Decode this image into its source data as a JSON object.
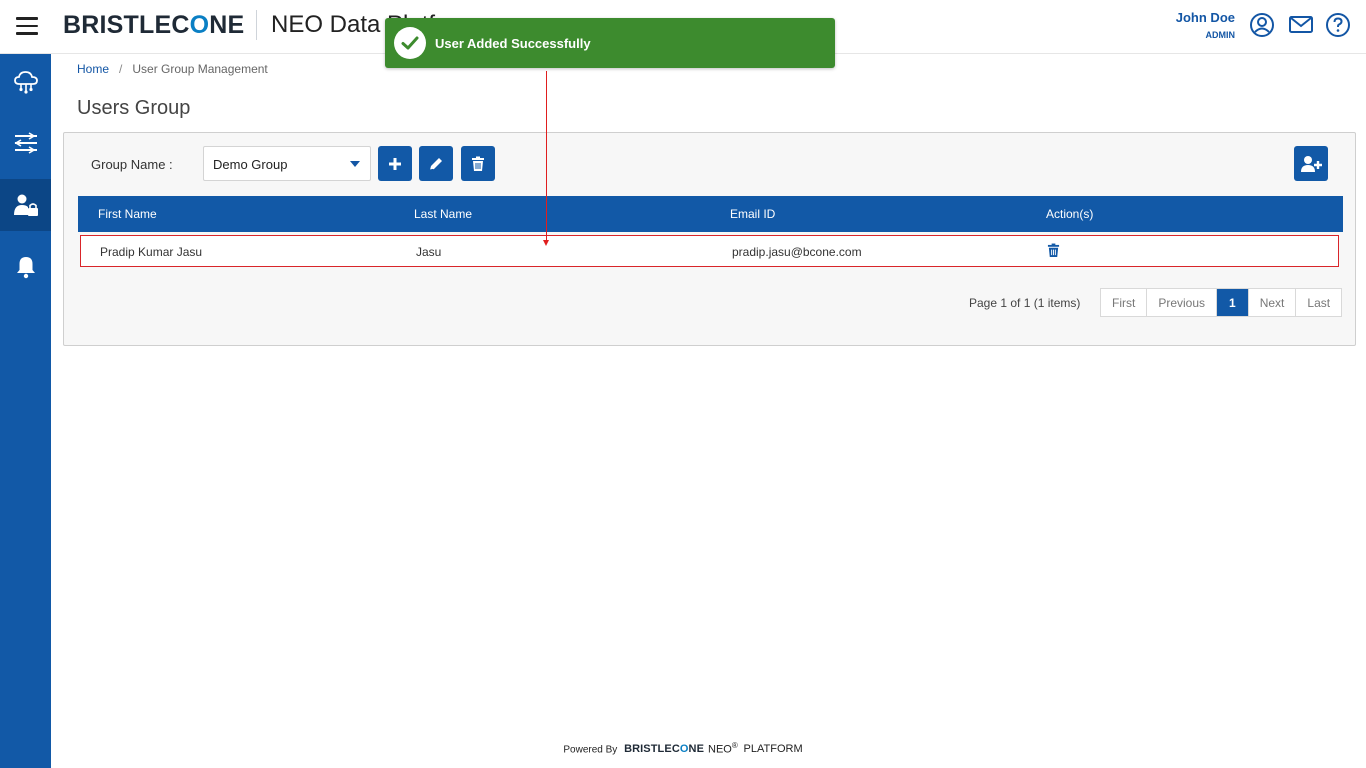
{
  "header": {
    "brand_pre": "BRISTLEC",
    "brand_o": "O",
    "brand_post": "NE",
    "app_title": "NEO Data Platf",
    "user_name": "John Doe",
    "user_role": "ADMIN"
  },
  "toast": {
    "message": "User Added Successfully",
    "color": "#3d8b2e"
  },
  "breadcrumb": {
    "home": "Home",
    "separator": "/",
    "current": "User Group Management"
  },
  "page_title": "Users Group",
  "form": {
    "group_label": "Group Name :",
    "group_value": "Demo Group"
  },
  "table": {
    "columns": [
      "First Name",
      "Last Name",
      "Email ID",
      "Action(s)"
    ],
    "rows": [
      {
        "first_name": "Pradip Kumar Jasu",
        "last_name": "Jasu",
        "email": "pradip.jasu@bcone.com"
      }
    ]
  },
  "pager": {
    "info": "Page 1 of 1 (1 items)",
    "first": "First",
    "previous": "Previous",
    "current": "1",
    "next": "Next",
    "last": "Last"
  },
  "footer": {
    "powered_by": "Powered By",
    "logo_pre": "BRISTLEC",
    "logo_o": "O",
    "logo_post": "NE",
    "neo": "NEO",
    "reg": "®",
    "platform": "PLATFORM"
  },
  "colors": {
    "primary": "#1259a7",
    "sidebar_active": "#0c4686",
    "highlight": "#d9252a",
    "accent_logo": "#0a7fc4"
  },
  "icons": [
    "menu-icon",
    "cloud-network-icon",
    "sliders-icon",
    "user-lock-icon",
    "bell-icon",
    "user-circle-icon",
    "mail-icon",
    "help-icon",
    "check-icon",
    "plus-icon",
    "pencil-icon",
    "trash-icon",
    "user-plus-icon"
  ]
}
